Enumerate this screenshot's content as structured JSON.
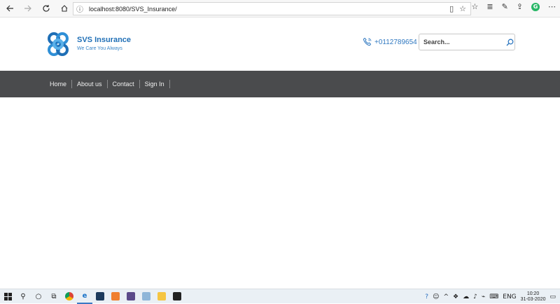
{
  "browser": {
    "url": "localhost:8080/SVS_Insurance/",
    "back_icon": "arrow-left-icon",
    "forward_icon": "arrow-right-icon",
    "refresh_icon": "refresh-icon",
    "home_icon": "home-icon",
    "profile_letter": "G"
  },
  "header": {
    "brand_title": "SVS Insurance",
    "brand_tagline": "We Care You Always",
    "phone": "+0112789654",
    "search_placeholder": "Search...",
    "brand_color": "#1f6fb6"
  },
  "nav": {
    "items": [
      {
        "label": "Home"
      },
      {
        "label": "About us"
      },
      {
        "label": "Contact"
      },
      {
        "label": "Sign In"
      }
    ],
    "background": "#4a4b4d"
  },
  "taskbar": {
    "language": "ENG",
    "time": "10:20",
    "date": "31-03-2020"
  }
}
